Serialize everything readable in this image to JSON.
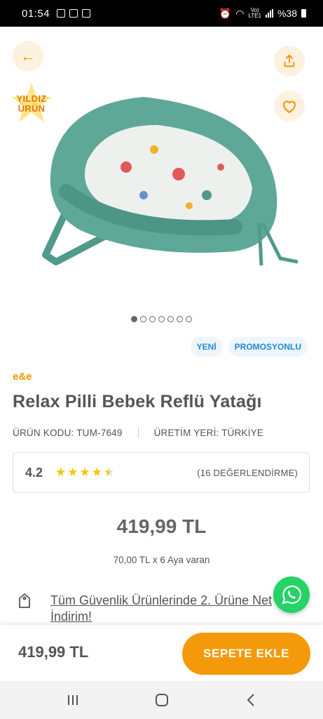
{
  "status_bar": {
    "time": "01:54",
    "network_label_top": "Vo)",
    "network_label_bottom": "LTE1",
    "battery": "%38"
  },
  "hero": {
    "back_icon": "arrow-left-icon",
    "share_icon": "share-icon",
    "favorite_icon": "heart-icon",
    "badge_line1": "YILDIZ",
    "badge_line2": "ÜRÜN",
    "image_count": 7,
    "active_image_index": 0
  },
  "tags": [
    "YENİ",
    "PROMOSYONLU"
  ],
  "product": {
    "brand": "e&e",
    "title": "Relax Pilli Bebek Reflü Yatağı",
    "code": "ÜRÜN KODU: TUM-7649",
    "origin": "ÜRETİM YERİ: TÜRKİYE"
  },
  "rating": {
    "value": "4.2",
    "stars": 4.5,
    "count_text": "(16 DEĞERLENDİRME)"
  },
  "price": "419,99 TL",
  "installment": "70,00 TL x 6 Aya varan",
  "promo": {
    "icon": "price-tag-icon",
    "text": "Tüm Güvenlik Ürünlerinde 2. Ürüne Net İndirim!"
  },
  "whatsapp_icon": "whatsapp-icon",
  "bottom_bar": {
    "price": "419,99 TL",
    "button": "SEPETE EKLE"
  },
  "nav": {
    "recents_icon": "recents-icon",
    "home_icon": "home-icon",
    "back_icon": "back-icon"
  },
  "colors": {
    "accent": "#f39200",
    "button": "#f49a0a",
    "tag_text": "#1c8ad4",
    "tag_bg": "#eef6fc",
    "star": "#f7c600",
    "whatsapp": "#25d366"
  }
}
